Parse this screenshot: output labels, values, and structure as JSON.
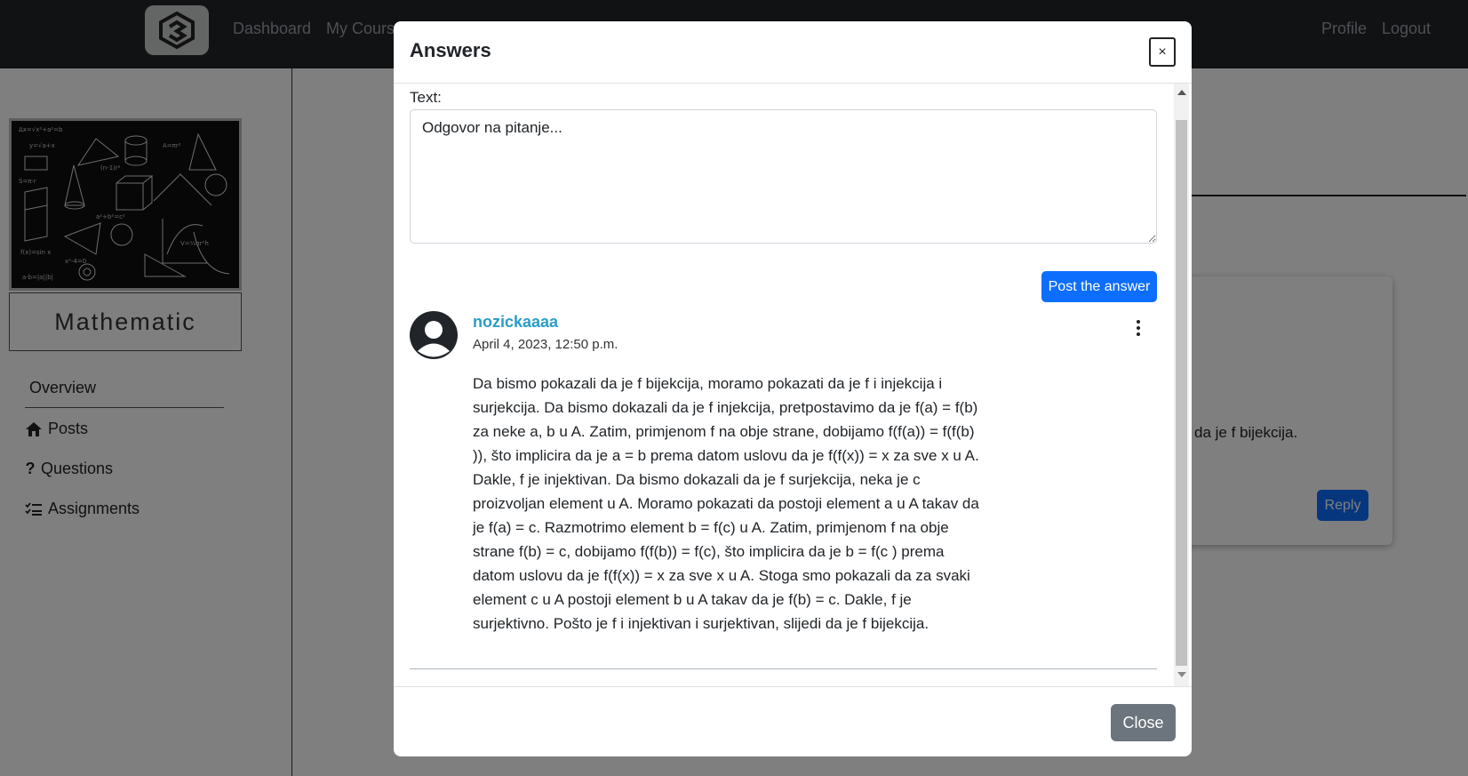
{
  "navbar": {
    "links_left": [
      "Dashboard",
      "My Cours"
    ],
    "links_right": [
      "Profile",
      "Logout"
    ]
  },
  "sidebar": {
    "course_name": "Mathematic",
    "items": [
      {
        "label": "Overview",
        "icon": ""
      },
      {
        "label": "Posts",
        "icon": "home-icon"
      },
      {
        "label": "Questions",
        "icon": "question-icon"
      },
      {
        "label": "Assignments",
        "icon": "list-check-icon"
      }
    ]
  },
  "background": {
    "card_text": "da je f bijekcija.",
    "reply_label": "Reply"
  },
  "modal": {
    "title": "Answers",
    "x_label": "×",
    "text_label": "Text:",
    "textarea_placeholder": "Odgovor na pitanje...",
    "post_button": "Post the answer",
    "answer": {
      "username": "nozickaaaa",
      "date": "April 4, 2023, 12:50 p.m.",
      "text": "Da bismo pokazali da je f bijekcija, moramo pokazati da je f i injekcija i surjekcija. Da bismo dokazali da je f injekcija, pretpostavimo da je f(a) = f(b) za neke a, b u A. Zatim, primjenom f na obje strane, dobijamo f(f(a)) = f(f(b) )), što implicira da je a = b prema datom uslovu da je f(f(x)) = x za sve x u A. Dakle, f je injektivan. Da bismo dokazali da je f surjekcija, neka je c proizvoljan element u A. Moramo pokazati da postoji element a u A takav da je f(a) = c. Razmotrimo element b = f(c) u A. Zatim, primjenom f na obje strane f(b) = c, dobijamo f(f(b)) = f(c), što implicira da je b = f(c ) prema datom uslovu da je f(f(x)) = x za sve x u A. Stoga smo pokazali da za svaki element c u A postoji element b u A takav da je f(b) = c. Dakle, f je surjektivno. Pošto je f i injektivan i surjektivan, slijedi da je f bijekcija."
    },
    "close_button": "Close"
  },
  "colors": {
    "navbar": "#212529",
    "primary": "#0d6efd",
    "secondary": "#6c757d",
    "username": "#2a9dc6"
  }
}
